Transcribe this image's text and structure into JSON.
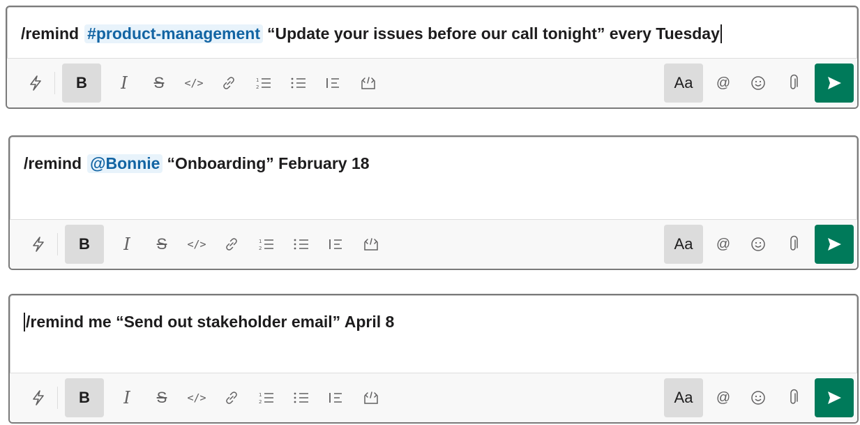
{
  "composers": [
    {
      "command": "/remind",
      "target": "#product-management",
      "message": "“Update your issues before our call tonight” every Tuesday"
    },
    {
      "command": "/remind",
      "target": "@Bonnie",
      "message": "“Onboarding” February 18"
    },
    {
      "text": "/remind me “Send out stakeholder email” April 8"
    }
  ],
  "toolbar": {
    "bold_label": "B",
    "italic_label": "I",
    "strike_label": "S",
    "code_label": "</>",
    "text_format_label": "Aa",
    "mention_label": "@"
  },
  "colors": {
    "send_button": "#007a5a",
    "mention_chip_bg": "#e8f3fb",
    "mention_chip_text": "#1264a3",
    "active_button_bg": "#dcdcdc"
  },
  "icons": [
    "shortcuts-bolt-icon",
    "link-icon",
    "numbered-list-icon",
    "bulleted-list-icon",
    "blockquote-icon",
    "code-block-icon",
    "emoji-icon",
    "attachment-icon",
    "send-icon"
  ]
}
